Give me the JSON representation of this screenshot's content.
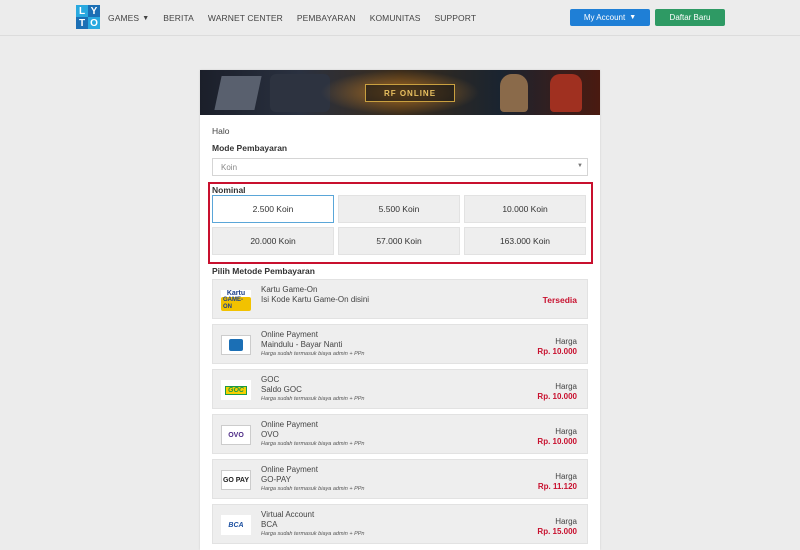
{
  "logo": {
    "letters": [
      "L",
      "Y",
      "T",
      "O"
    ]
  },
  "nav": {
    "items": [
      {
        "label": "GAMES",
        "has_caret": true
      },
      {
        "label": "BERITA"
      },
      {
        "label": "WARNET CENTER"
      },
      {
        "label": "PEMBAYARAN"
      },
      {
        "label": "KOMUNITAS"
      },
      {
        "label": "SUPPORT"
      }
    ],
    "account_label": "My Account",
    "register_label": "Daftar Baru",
    "account_color": "#1f7fd6",
    "register_color": "#2e9a64"
  },
  "banner": {
    "logo_text": "RF ONLINE"
  },
  "form": {
    "greeting": "Halo",
    "mode_label": "Mode Pembayaran",
    "mode_value": "Koin",
    "nominal_label": "Nominal",
    "nominals": [
      "2.500 Koin",
      "5.500 Koin",
      "10.000 Koin",
      "20.000 Koin",
      "57.000 Koin",
      "163.000 Koin"
    ],
    "selected_nominal": "2.500 Koin",
    "method_label": "Pilih Metode Pembayaran"
  },
  "methods": [
    {
      "icon": "kartu-game-on-icon",
      "icon_text": "Kartu",
      "icon_text2": "GAME-ON",
      "line1": "Kartu Game-On",
      "line2": "Isi Kode Kartu Game-On disini",
      "status": "Tersedia"
    },
    {
      "icon": "maindulu-icon",
      "line1": "Online Payment",
      "line2": "Maindulu - Bayar Nanti",
      "note": "Harga sudah termasuk biaya admin + PPn",
      "harga_label": "Harga",
      "price": "Rp. 10.000"
    },
    {
      "icon": "goc-icon",
      "icon_text": "GOC",
      "line1": "GOC",
      "line2": "Saldo GOC",
      "note": "Harga sudah termasuk biaya admin + PPn",
      "harga_label": "Harga",
      "price": "Rp. 10.000"
    },
    {
      "icon": "ovo-icon",
      "icon_text": "OVO",
      "line1": "Online Payment",
      "line2": "OVO",
      "note": "Harga sudah termasuk biaya admin + PPn",
      "harga_label": "Harga",
      "price": "Rp. 10.000"
    },
    {
      "icon": "gopay-icon",
      "icon_text": "GO PAY",
      "line1": "Online Payment",
      "line2": "GO-PAY",
      "note": "Harga sudah termasuk biaya admin + PPn",
      "harga_label": "Harga",
      "price": "Rp. 11.120"
    },
    {
      "icon": "bca-icon",
      "icon_text": "BCA",
      "line1": "Virtual Account",
      "line2": "BCA",
      "note": "Harga sudah termasuk biaya admin + PPn",
      "harga_label": "Harga",
      "price": "Rp. 15.000"
    }
  ],
  "colors": {
    "highlight_border": "#c8102e",
    "price": "#c8102e",
    "selected_border": "#5aa6d8"
  }
}
